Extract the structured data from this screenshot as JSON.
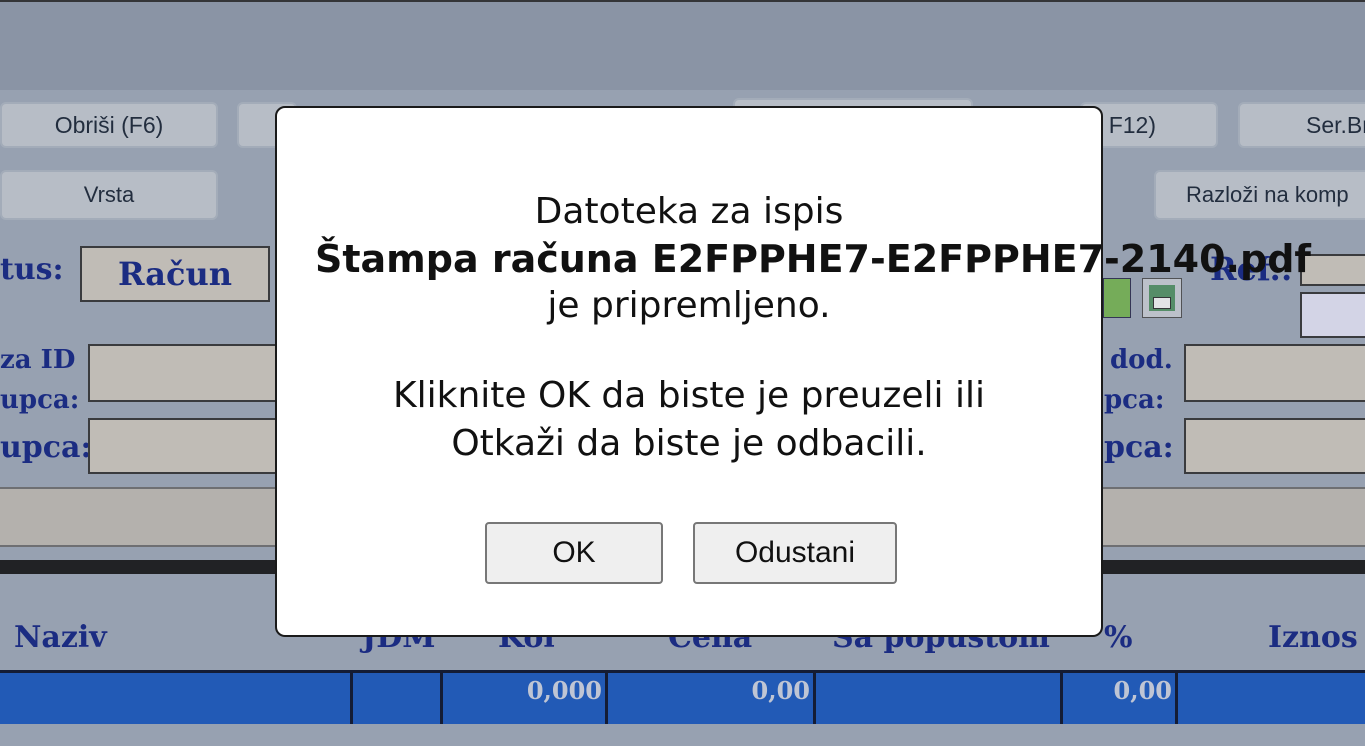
{
  "toolbar": {
    "delete_label": "Obriši (F6)",
    "f12_label": "F12)",
    "serbr_label": "Ser.Br.",
    "type_label": "Vrsta",
    "decompose_label": "Razloži na komp"
  },
  "form": {
    "status_label": "tus:",
    "status_value": "Račun",
    "buyer_id_label_1": "za ID",
    "buyer_id_label_2": "upca:",
    "buyer_label": "upca:",
    "ref_label": "Ref.:",
    "add_label_1": "dod.",
    "add_label_2": "pca:",
    "add_label_3": "pca:"
  },
  "grid": {
    "headers": [
      "Naziv",
      "JDM",
      "Kol",
      "Cena",
      "Sa popustom",
      "%",
      "Iznos"
    ],
    "row": {
      "kol": "0,000",
      "cena": "0,00",
      "pct": "0,00"
    }
  },
  "dialog": {
    "line1": "Datoteka za ispis",
    "file": "Štampa računa E2FPPHE7-E2FPPHE7-2140.pdf",
    "line3": "je pripremljeno.",
    "line4": "Kliknite OK da biste je preuzeli ili",
    "line5": "Otkaži da biste je odbacili.",
    "ok_label": "OK",
    "cancel_label": "Odustani"
  }
}
